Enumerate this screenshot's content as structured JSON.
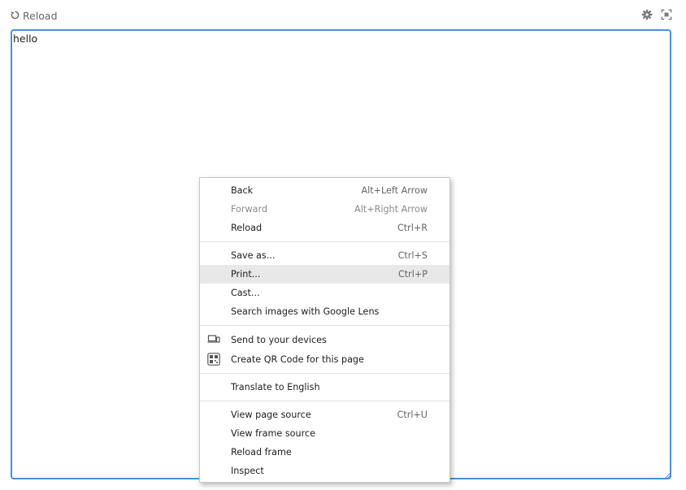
{
  "toolbar": {
    "reload_label": "Reload",
    "reload_icon": "reload-icon",
    "settings_icon": "gear-icon",
    "fullscreen_icon": "fullscreen-icon"
  },
  "frame": {
    "content_text": "hello",
    "border_color": "#4a90d9"
  },
  "context_menu": {
    "groups": [
      [
        {
          "label": "Back",
          "shortcut": "Alt+Left Arrow"
        },
        {
          "label": "Forward",
          "shortcut": "Alt+Right Arrow",
          "disabled": true
        },
        {
          "label": "Reload",
          "shortcut": "Ctrl+R"
        }
      ],
      [
        {
          "label": "Save as...",
          "shortcut": "Ctrl+S"
        },
        {
          "label": "Print...",
          "shortcut": "Ctrl+P",
          "highlighted": true
        },
        {
          "label": "Cast...",
          "shortcut": ""
        },
        {
          "label": "Search images with Google Lens",
          "shortcut": ""
        }
      ],
      [
        {
          "label": "Send to your devices",
          "shortcut": "",
          "icon": "devices-icon"
        },
        {
          "label": "Create QR Code for this page",
          "shortcut": "",
          "icon": "qr-code-icon"
        }
      ],
      [
        {
          "label": "Translate to English",
          "shortcut": ""
        }
      ],
      [
        {
          "label": "View page source",
          "shortcut": "Ctrl+U"
        },
        {
          "label": "View frame source",
          "shortcut": ""
        },
        {
          "label": "Reload frame",
          "shortcut": ""
        },
        {
          "label": "Inspect",
          "shortcut": ""
        }
      ]
    ],
    "highlight_color": "#e8e8e8"
  }
}
